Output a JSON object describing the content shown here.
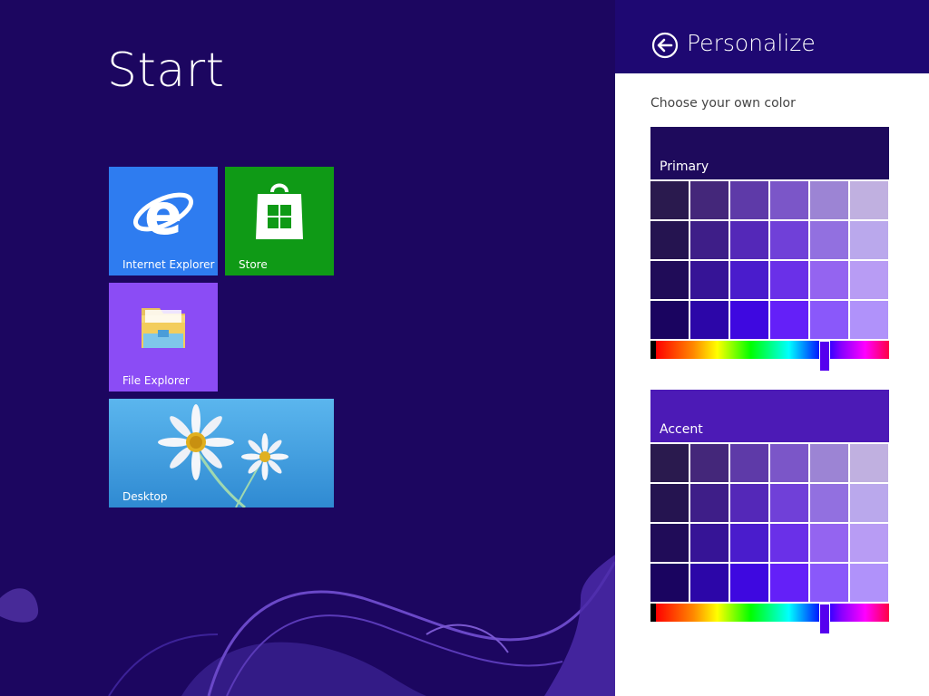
{
  "start": {
    "title": "Start",
    "background_color": "#1c0660",
    "tiles": [
      {
        "label": "Internet Explorer",
        "icon": "internet-explorer-icon",
        "color": "#2e7cf0"
      },
      {
        "label": "Store",
        "icon": "store-icon",
        "color": "#0f9a16"
      },
      {
        "label": "File Explorer",
        "icon": "file-explorer-icon",
        "color": "#8b4cf5"
      },
      {
        "label": "Desktop",
        "icon": "desktop-wallpaper-image",
        "color": "#4aa5e6"
      }
    ]
  },
  "panel": {
    "title": "Personalize",
    "back_icon": "back-arrow-icon",
    "header_color": "#1e0872",
    "choose_label": "Choose your own color",
    "primary": {
      "label": "Primary",
      "preview_color": "#1e0a5c",
      "hue_position": 0.73,
      "swatches": [
        [
          "#2a1a4e",
          "#44277a",
          "#5e3aa8",
          "#7b56c8",
          "#9c84d4",
          "#c0b0e0"
        ],
        [
          "#251450",
          "#3e1e88",
          "#5428b8",
          "#7040d8",
          "#9270e0",
          "#baa8ec"
        ],
        [
          "#200c58",
          "#361496",
          "#4a1ccc",
          "#6a30e8",
          "#9464f0",
          "#b89cf4"
        ],
        [
          "#1a0460",
          "#2c06a8",
          "#3e08e0",
          "#6420f8",
          "#8a58fa",
          "#b092fa"
        ]
      ]
    },
    "accent": {
      "label": "Accent",
      "preview_color": "#4c1ab6",
      "hue_position": 0.73,
      "swatches": [
        [
          "#2a1a4e",
          "#44277a",
          "#5e3aa8",
          "#7b56c8",
          "#9c84d4",
          "#c0b0e0"
        ],
        [
          "#251450",
          "#3e1e88",
          "#5428b8",
          "#7040d8",
          "#9270e0",
          "#baa8ec"
        ],
        [
          "#200c58",
          "#361496",
          "#4a1ccc",
          "#6a30e8",
          "#9464f0",
          "#b89cf4"
        ],
        [
          "#1a0460",
          "#2c06a8",
          "#3e08e0",
          "#6420f8",
          "#8a58fa",
          "#b092fa"
        ]
      ]
    }
  }
}
